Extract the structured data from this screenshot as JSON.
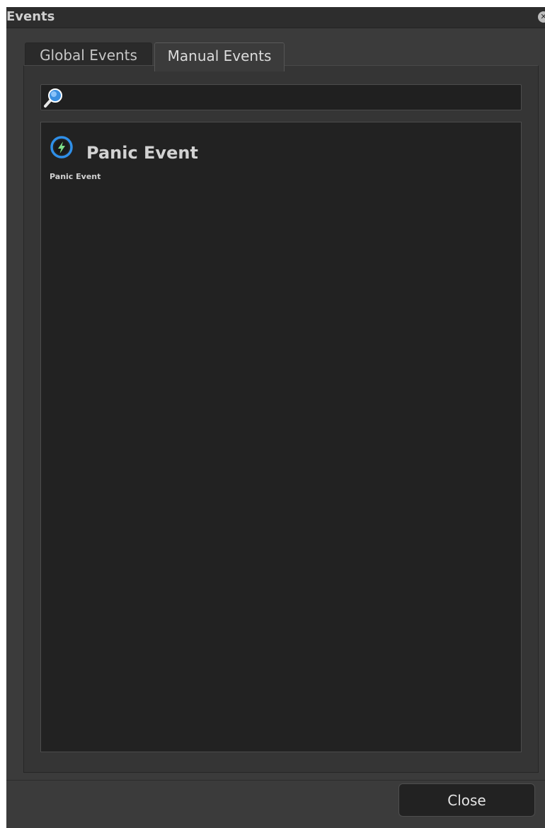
{
  "window": {
    "title": "Events",
    "close_icon": "close-circle-icon"
  },
  "tabs": [
    {
      "label": "Global Events",
      "active": false
    },
    {
      "label": "Manual Events",
      "active": true
    }
  ],
  "search": {
    "value": "",
    "placeholder": "",
    "icon": "magnifier-icon"
  },
  "events": [
    {
      "title": "Panic Event",
      "description": "Panic Event",
      "icon": "lightning-bolt-icon"
    }
  ],
  "footer": {
    "close_label": "Close"
  },
  "colors": {
    "window_bg": "#3b3b3b",
    "titlebar_bg": "#2d2d2d",
    "list_bg": "#222222",
    "accent_blue": "#2f8fe8"
  }
}
